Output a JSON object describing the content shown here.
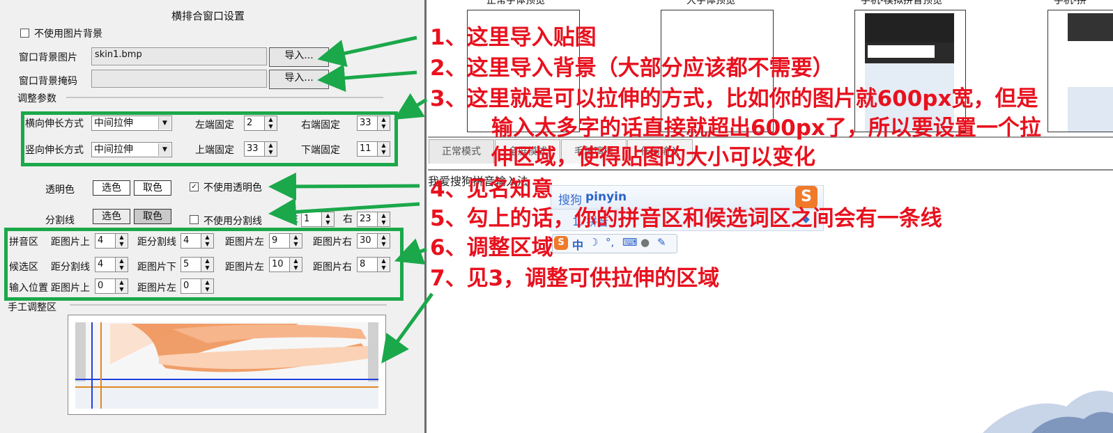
{
  "panel": {
    "title": "横排合窗口设置",
    "no_bg_image_label": "不使用图片背景",
    "bg_image_label": "窗口背景图片",
    "bg_image_value": "skin1.bmp",
    "bg_mask_label": "窗口背景掩码",
    "bg_mask_value": "",
    "import_label": "导入...",
    "adjust_params_label": "调整参数",
    "h_stretch_label": "横向伸长方式",
    "h_stretch_value": "中间拉伸",
    "v_stretch_label": "竖向伸长方式",
    "v_stretch_value": "中间拉伸",
    "left_fix_label": "左端固定",
    "left_fix_value": "2",
    "right_fix_label": "右端固定",
    "right_fix_value": "33",
    "top_fix_label": "上端固定",
    "top_fix_value": "33",
    "bottom_fix_label": "下端固定",
    "bottom_fix_value": "11",
    "transparent_label": "透明色",
    "pick_color_label": "选色",
    "get_color_label": "取色",
    "no_transparent_label": "不使用透明色",
    "divider_label": "分割线",
    "no_divider_label": "不使用分割线",
    "divider_left_label": "左",
    "divider_left_value": "1",
    "divider_right_label": "右",
    "divider_right_value": "23",
    "pinyin_area_label": "拼音区",
    "candidate_area_label": "候选区",
    "input_pos_label": "输入位置",
    "dist_top_label": "距图片上",
    "dist_divider_label": "距分割线",
    "dist_left_label": "距图片左",
    "dist_right_label": "距图片右",
    "dist_bottom_label": "距图片下",
    "pinyin_top": "4",
    "pinyin_divider": "4",
    "pinyin_left": "9",
    "pinyin_right": "30",
    "cand_divider": "4",
    "cand_bottom": "5",
    "cand_left": "10",
    "cand_right": "8",
    "input_top": "0",
    "input_left": "0",
    "manual_adjust_label": "手工调整区"
  },
  "preview": {
    "headers": [
      "正常字体预览",
      "大字体预览",
      "手机-模拟拼音预览",
      "手机-拼"
    ],
    "tabs": [
      "正常模式",
      "全屏模式",
      "毛玻璃模",
      "任何输入"
    ],
    "input_text": "我爱搜狗拼音输入法",
    "ime_brand": "搜狗",
    "ime_pinyin": "pinyin",
    "ime_candidates": "1. 拼音",
    "ime_toolbar": "中"
  },
  "annotations": [
    "1、这里导入贴图",
    "2、这里导入背景（大部分应该都不需要）",
    "3、这里就是可以拉伸的方式，比如你的图片就600px宽，但是",
    "输入太多字的话直接就超出600px了，所以要设置一个拉",
    "伸区域，使得贴图的大小可以变化",
    "4、见名知意",
    "5、勾上的话，你的拼音区和候选词区之间会有一条线",
    "6、调整区域",
    "7、见3，调整可供拉伸的区域"
  ],
  "colors": {
    "accent_green": "#1ba84a",
    "annotation_red": "#e8111e",
    "skin_orange": "#f0955a"
  }
}
